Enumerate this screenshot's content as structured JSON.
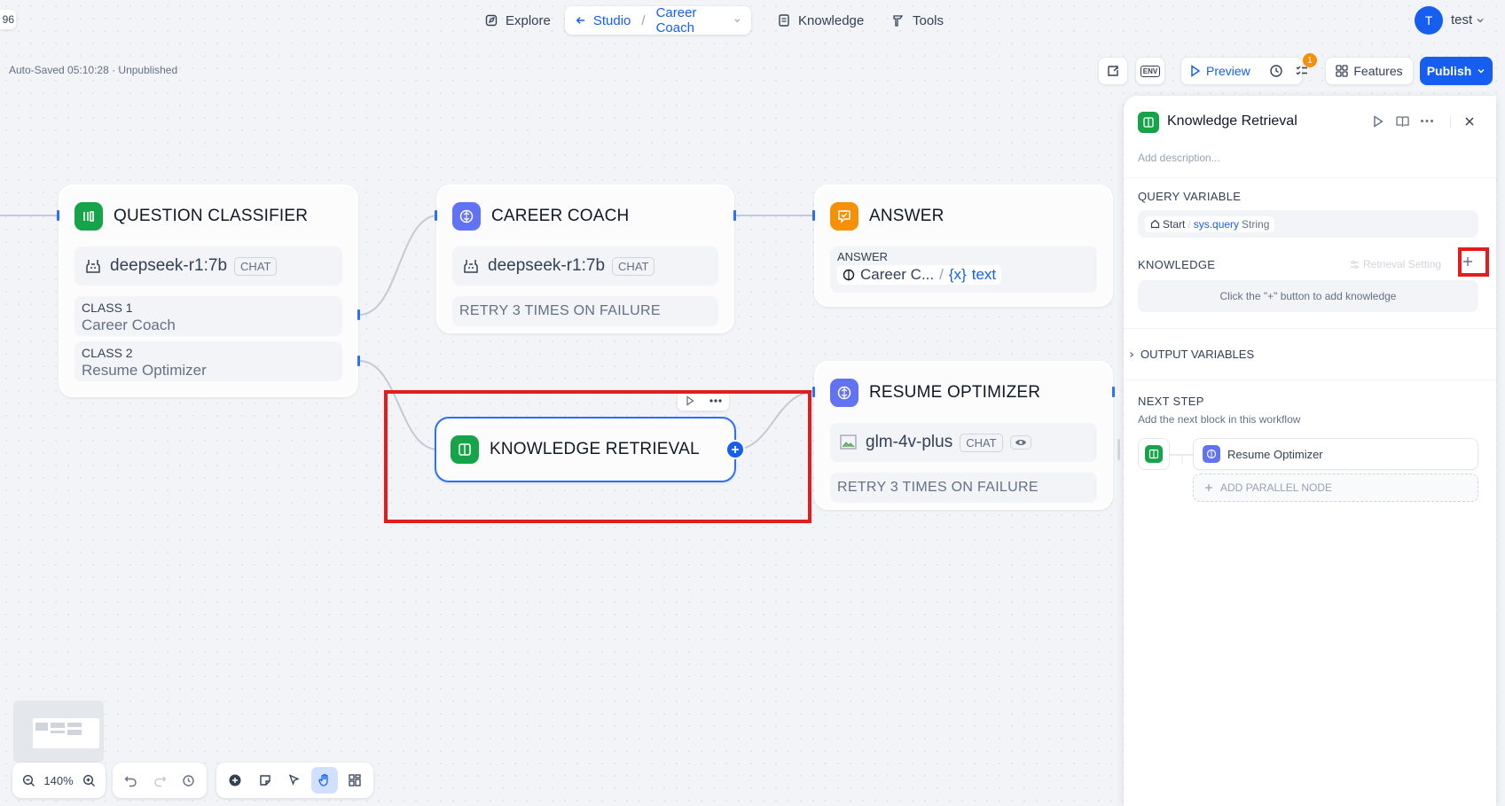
{
  "topbar": {
    "page_count_fragment": "96",
    "explore": "Explore",
    "studio": "Studio",
    "app_name": "Career Coach",
    "knowledge": "Knowledge",
    "tools": "Tools",
    "avatar_letter": "T",
    "user": "test"
  },
  "actions": {
    "autosave": "Auto-Saved 05:10:28 · Unpublished",
    "env": "ENV",
    "preview": "Preview",
    "checklist_badge": "1",
    "features": "Features",
    "publish": "Publish"
  },
  "nodes": {
    "classifier": {
      "title": "QUESTION CLASSIFIER",
      "model": "deepseek-r1:7b",
      "mode": "CHAT",
      "classes": [
        {
          "label": "CLASS 1",
          "value": "Career Coach"
        },
        {
          "label": "CLASS 2",
          "value": "Resume Optimizer"
        }
      ]
    },
    "career_coach": {
      "title": "CAREER COACH",
      "model": "deepseek-r1:7b",
      "mode": "CHAT",
      "retry": "RETRY 3 TIMES ON FAILURE"
    },
    "answer": {
      "title": "ANSWER",
      "label": "ANSWER",
      "source": "Career C...",
      "var": "text"
    },
    "knowledge_retrieval": {
      "title": "KNOWLEDGE RETRIEVAL"
    },
    "resume_optimizer": {
      "title": "RESUME OPTIMIZER",
      "model": "glm-4v-plus",
      "mode": "CHAT",
      "retry": "RETRY 3 TIMES ON FAILURE"
    }
  },
  "panel": {
    "title": "Knowledge Retrieval",
    "description_placeholder": "Add description...",
    "query_variable_label": "QUERY VARIABLE",
    "query_node": "Start",
    "query_var": "sys.query",
    "query_type": "String",
    "knowledge_label": "KNOWLEDGE",
    "retrieval_setting": "Retrieval Setting",
    "knowledge_empty": "Click the \"+\" button to add knowledge",
    "output_variables": "OUTPUT VARIABLES",
    "next_step": "NEXT STEP",
    "next_step_desc": "Add the next block in this workflow",
    "next_node": "Resume Optimizer",
    "add_parallel": "ADD PARALLEL NODE"
  },
  "bottom_toolbar": {
    "zoom": "140%"
  },
  "colors": {
    "accent": "#155eef",
    "highlight": "#e11d1d",
    "green": "#16a34a",
    "indigo": "#6172f3",
    "orange": "#f79009"
  }
}
